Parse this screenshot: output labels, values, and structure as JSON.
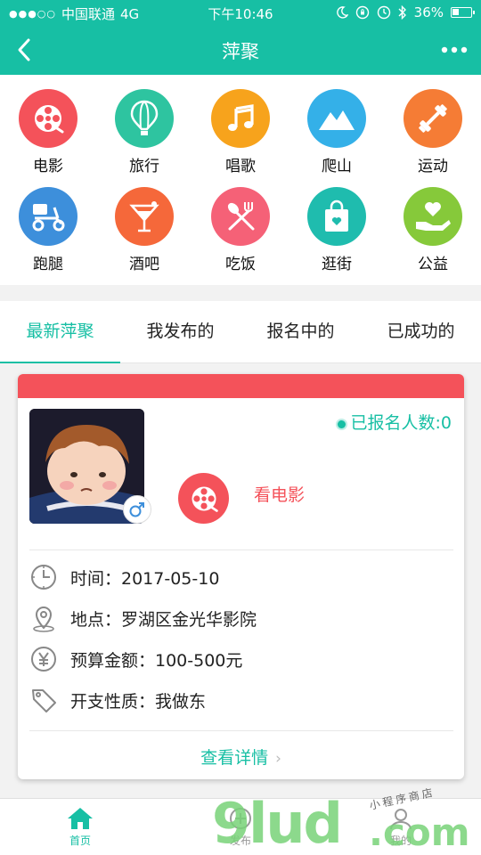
{
  "status_bar": {
    "carrier": "中国联通",
    "network": "4G",
    "time": "下午10:46",
    "battery": "36%"
  },
  "nav": {
    "title": "萍聚"
  },
  "categories": [
    {
      "label": "电影",
      "icon": "film-reel-icon",
      "color": "#f4525a"
    },
    {
      "label": "旅行",
      "icon": "hot-air-balloon-icon",
      "color": "#2ec4a0"
    },
    {
      "label": "唱歌",
      "icon": "music-note-icon",
      "color": "#f7a31c"
    },
    {
      "label": "爬山",
      "icon": "mountain-icon",
      "color": "#34b0e8"
    },
    {
      "label": "运动",
      "icon": "dumbbell-icon",
      "color": "#f57c35"
    },
    {
      "label": "跑腿",
      "icon": "scooter-icon",
      "color": "#3d8fdb"
    },
    {
      "label": "酒吧",
      "icon": "cocktail-icon",
      "color": "#f5683a"
    },
    {
      "label": "吃饭",
      "icon": "fork-spoon-icon",
      "color": "#f56177"
    },
    {
      "label": "逛街",
      "icon": "shopping-bag-icon",
      "color": "#1fbcae"
    },
    {
      "label": "公益",
      "icon": "heart-hand-icon",
      "color": "#86c93a"
    }
  ],
  "tabs": [
    {
      "label": "最新萍聚",
      "active": true
    },
    {
      "label": "我发布的",
      "active": false
    },
    {
      "label": "报名中的",
      "active": false
    },
    {
      "label": "已成功的",
      "active": false
    }
  ],
  "card": {
    "enrolled_text": "已报名人数:0",
    "activity_name": "看电影",
    "rows": [
      {
        "icon": "clock-icon",
        "text": "时间：2017-05-10"
      },
      {
        "icon": "location-pin-icon",
        "text": "地点：罗湖区金光华影院"
      },
      {
        "icon": "yuan-coin-icon",
        "text": "预算金额：100-500元"
      },
      {
        "icon": "price-tag-icon",
        "text": "开支性质：我做东"
      }
    ],
    "details_label": "查看详情",
    "accent_color": "#f4525a"
  },
  "tabbar": {
    "items": [
      {
        "label": "首页",
        "icon": "home-icon",
        "active": true
      },
      {
        "label": "发布",
        "icon": "add-icon",
        "active": false
      },
      {
        "label": "我的",
        "icon": "user-icon",
        "active": false
      }
    ]
  },
  "watermark": {
    "brand": "9lud",
    "domain": ".com",
    "script": "小程序商店"
  },
  "colors": {
    "primary": "#17bfa4",
    "accent": "#f4525a"
  }
}
